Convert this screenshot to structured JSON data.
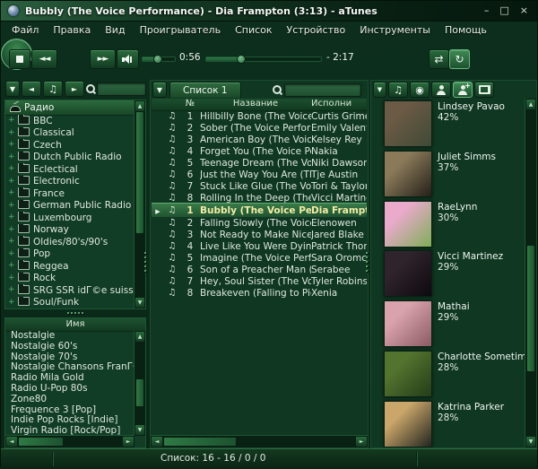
{
  "window": {
    "title": "Bubbly (The Voice Performance) - Dia Frampton (3:13) - aTunes",
    "minimize": "–",
    "maximize": "□",
    "close": "×"
  },
  "menu": {
    "items": [
      "Файл",
      "Правка",
      "Вид",
      "Проигрыватель",
      "Список",
      "Устройство",
      "Инструменты",
      "Помощь"
    ]
  },
  "icons": {
    "dropdown": "▼",
    "back": "◄",
    "forward": "►",
    "note": "♫",
    "play": "▶",
    "rew": "◄◄",
    "ffwd": "►►",
    "shuffle": "⇄",
    "repeat": "↻",
    "disc": "◉",
    "up": "▲",
    "down": "▼",
    "left": "◄",
    "right": "►",
    "expand": "+"
  },
  "player": {
    "elapsed": "0:56",
    "remaining": "- 2:17",
    "volume_pct": 45,
    "progress_pct": 30
  },
  "sidebar": {
    "search_value": "",
    "tree_root": "Радио",
    "tree_items": [
      "BBC",
      "Classical",
      "Czech",
      "Dutch Public Radio",
      "Eclectical",
      "Electronic",
      "France",
      "German Public Radio",
      "Luxembourg",
      "Norway",
      "Oldies/80's/90's",
      "Pop",
      "Reggea",
      "Rock",
      "SRG SSR idГ©e suisse",
      "Soul/Funk"
    ],
    "stations_header": "Имя",
    "stations": [
      "Nostalgie",
      "Nostalgie 60's",
      "Nostalgie 70's",
      "Nostalgie Chansons FranГ§aises",
      "Radio Mila Gold",
      "Radio U-Pop 80s",
      "Zone80",
      "Frequence 3 [Pop]",
      "Indie Pop Rocks [Indie]",
      "Virgin Radio [Rock/Pop]"
    ]
  },
  "playlist": {
    "tab_label": "Список 1",
    "search_value": "",
    "columns": {
      "num": "№",
      "title": "Название",
      "artist": "Исполни"
    },
    "rows": [
      {
        "num": "1",
        "title": "Hillbilly Bone (The Voice ...",
        "artist": "Curtis Grimes"
      },
      {
        "num": "2",
        "title": "Sober (The Voice Perform...",
        "artist": "Emily Valentine"
      },
      {
        "num": "3",
        "title": "American Boy (The Voice ...",
        "artist": "Kelsey Rey"
      },
      {
        "num": "4",
        "title": "Forget You (The Voice Pe...",
        "artist": "Nakia"
      },
      {
        "num": "5",
        "title": "Teenage Dream (The Voic...",
        "artist": "Niki Dawson"
      },
      {
        "num": "6",
        "title": "Just the Way You Are (Th...",
        "artist": "Tje Austin"
      },
      {
        "num": "7",
        "title": "Stuck Like Glue (The Voic...",
        "artist": "Tori & Taylor Th"
      },
      {
        "num": "8",
        "title": "Rolling In the Deep (The ...",
        "artist": "Vicci Martinez"
      },
      {
        "num": "1",
        "title": "Bubbly (The Voice Perfo...",
        "artist": "Dia Frampton",
        "selected": true,
        "playing": true
      },
      {
        "num": "2",
        "title": "Falling Slowly (The Voice ...",
        "artist": "Elenowen"
      },
      {
        "num": "3",
        "title": "Not Ready to Make Nice (...",
        "artist": "Jared Blake"
      },
      {
        "num": "4",
        "title": "Live Like You Were Dying ...",
        "artist": "Patrick Thomas"
      },
      {
        "num": "5",
        "title": "Imagine (The Voice Perfo...",
        "artist": "Sara Oromchi"
      },
      {
        "num": "6",
        "title": "Son of a Preacher Man (T...",
        "artist": "Serabee"
      },
      {
        "num": "7",
        "title": "Hey, Soul Sister (The Voic...",
        "artist": "Tyler Robinson"
      },
      {
        "num": "8",
        "title": "Breakeven (Falling to Piec...",
        "artist": "Xenia"
      }
    ]
  },
  "context": {
    "artists": [
      {
        "name": "Lindsey Pavao",
        "match": "42%",
        "c1": "#6b5a45",
        "c2": "#3f4a35"
      },
      {
        "name": "Juliet Simms",
        "match": "37%",
        "c1": "#8a7a5a",
        "c2": "#241f18"
      },
      {
        "name": "RaeLynn",
        "match": "30%",
        "c1": "#e9aacb",
        "c2": "#7fae57"
      },
      {
        "name": "Vicci Martinez",
        "match": "29%",
        "c1": "#30242c",
        "c2": "#0d0a0e"
      },
      {
        "name": "Mathai",
        "match": "29%",
        "c1": "#d9a3ad",
        "c2": "#8a5a62"
      },
      {
        "name": "Charlotte Sometimes",
        "match": "28%",
        "c1": "#53742f",
        "c2": "#243d18"
      },
      {
        "name": "Katrina Parker",
        "match": "28%",
        "c1": "#caa66a",
        "c2": "#23251f"
      }
    ]
  },
  "status": {
    "text": "Список: 16 - 16 / 0 / 0"
  },
  "colors": {
    "accent": "#2f7a44",
    "selection_text": "#f2eda6",
    "background": "#0d2f1d"
  }
}
